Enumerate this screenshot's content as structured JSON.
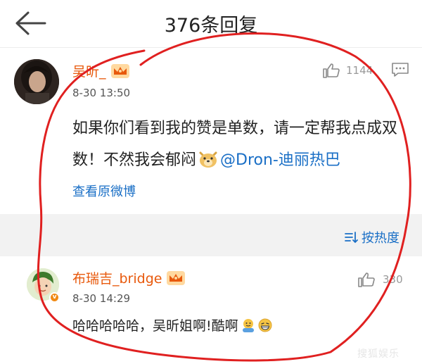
{
  "header": {
    "title": "376条回复"
  },
  "main_comment": {
    "username": "吴昕_",
    "time": "8-30 13:50",
    "text": "如果你们看到我的赞是单数，请一定帮我点成双数！不然我会郁闷",
    "mention": "@Dron-迪丽热巴",
    "likes": "1144",
    "view_original": "查看原微博"
  },
  "sort": {
    "label": "按热度"
  },
  "reply": {
    "username": "布瑞吉_bridge",
    "time": "8-30 14:29",
    "text": "哈哈哈哈哈，吴昕姐啊!酷啊",
    "likes": "330"
  },
  "watermark": "搜狐娱乐",
  "colors": {
    "accent_blue": "#1a6fc6",
    "username_orange": "#e8590c",
    "annotation_red": "#e02020",
    "band_gray": "#f2f2f2"
  }
}
